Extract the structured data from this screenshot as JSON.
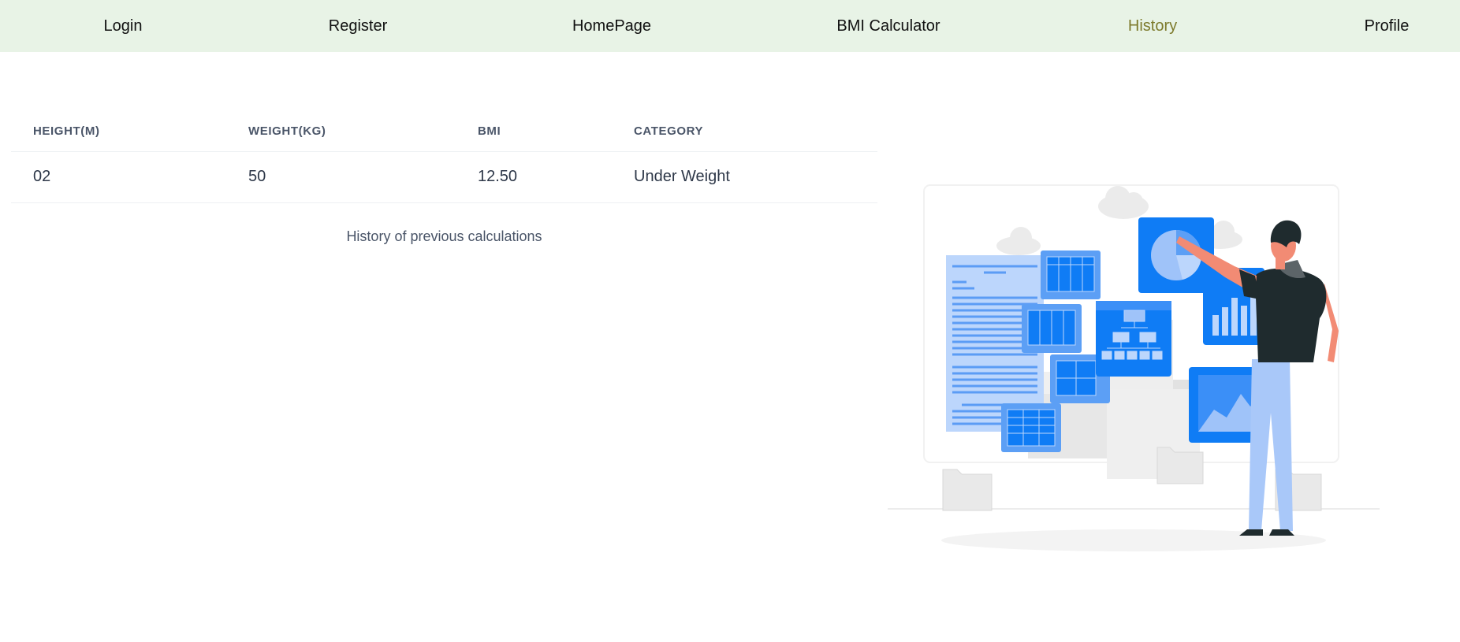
{
  "nav": {
    "login": "Login",
    "register": "Register",
    "homepage": "HomePage",
    "bmi_calculator": "BMI Calculator",
    "history": "History",
    "profile": "Profile",
    "active": "History",
    "active_color": "#7d7a2c",
    "background": "#e8f3e6"
  },
  "table": {
    "headers": [
      "HEIGHT(M)",
      "WEIGHT(KG)",
      "BMI",
      "CATEGORY"
    ],
    "rows": [
      [
        "02",
        "50",
        "12.50",
        "Under Weight"
      ]
    ],
    "caption": "History of previous calculations"
  },
  "illustration": {
    "icon": "data-analysis-illustration",
    "accent": "#0f7cf5"
  }
}
